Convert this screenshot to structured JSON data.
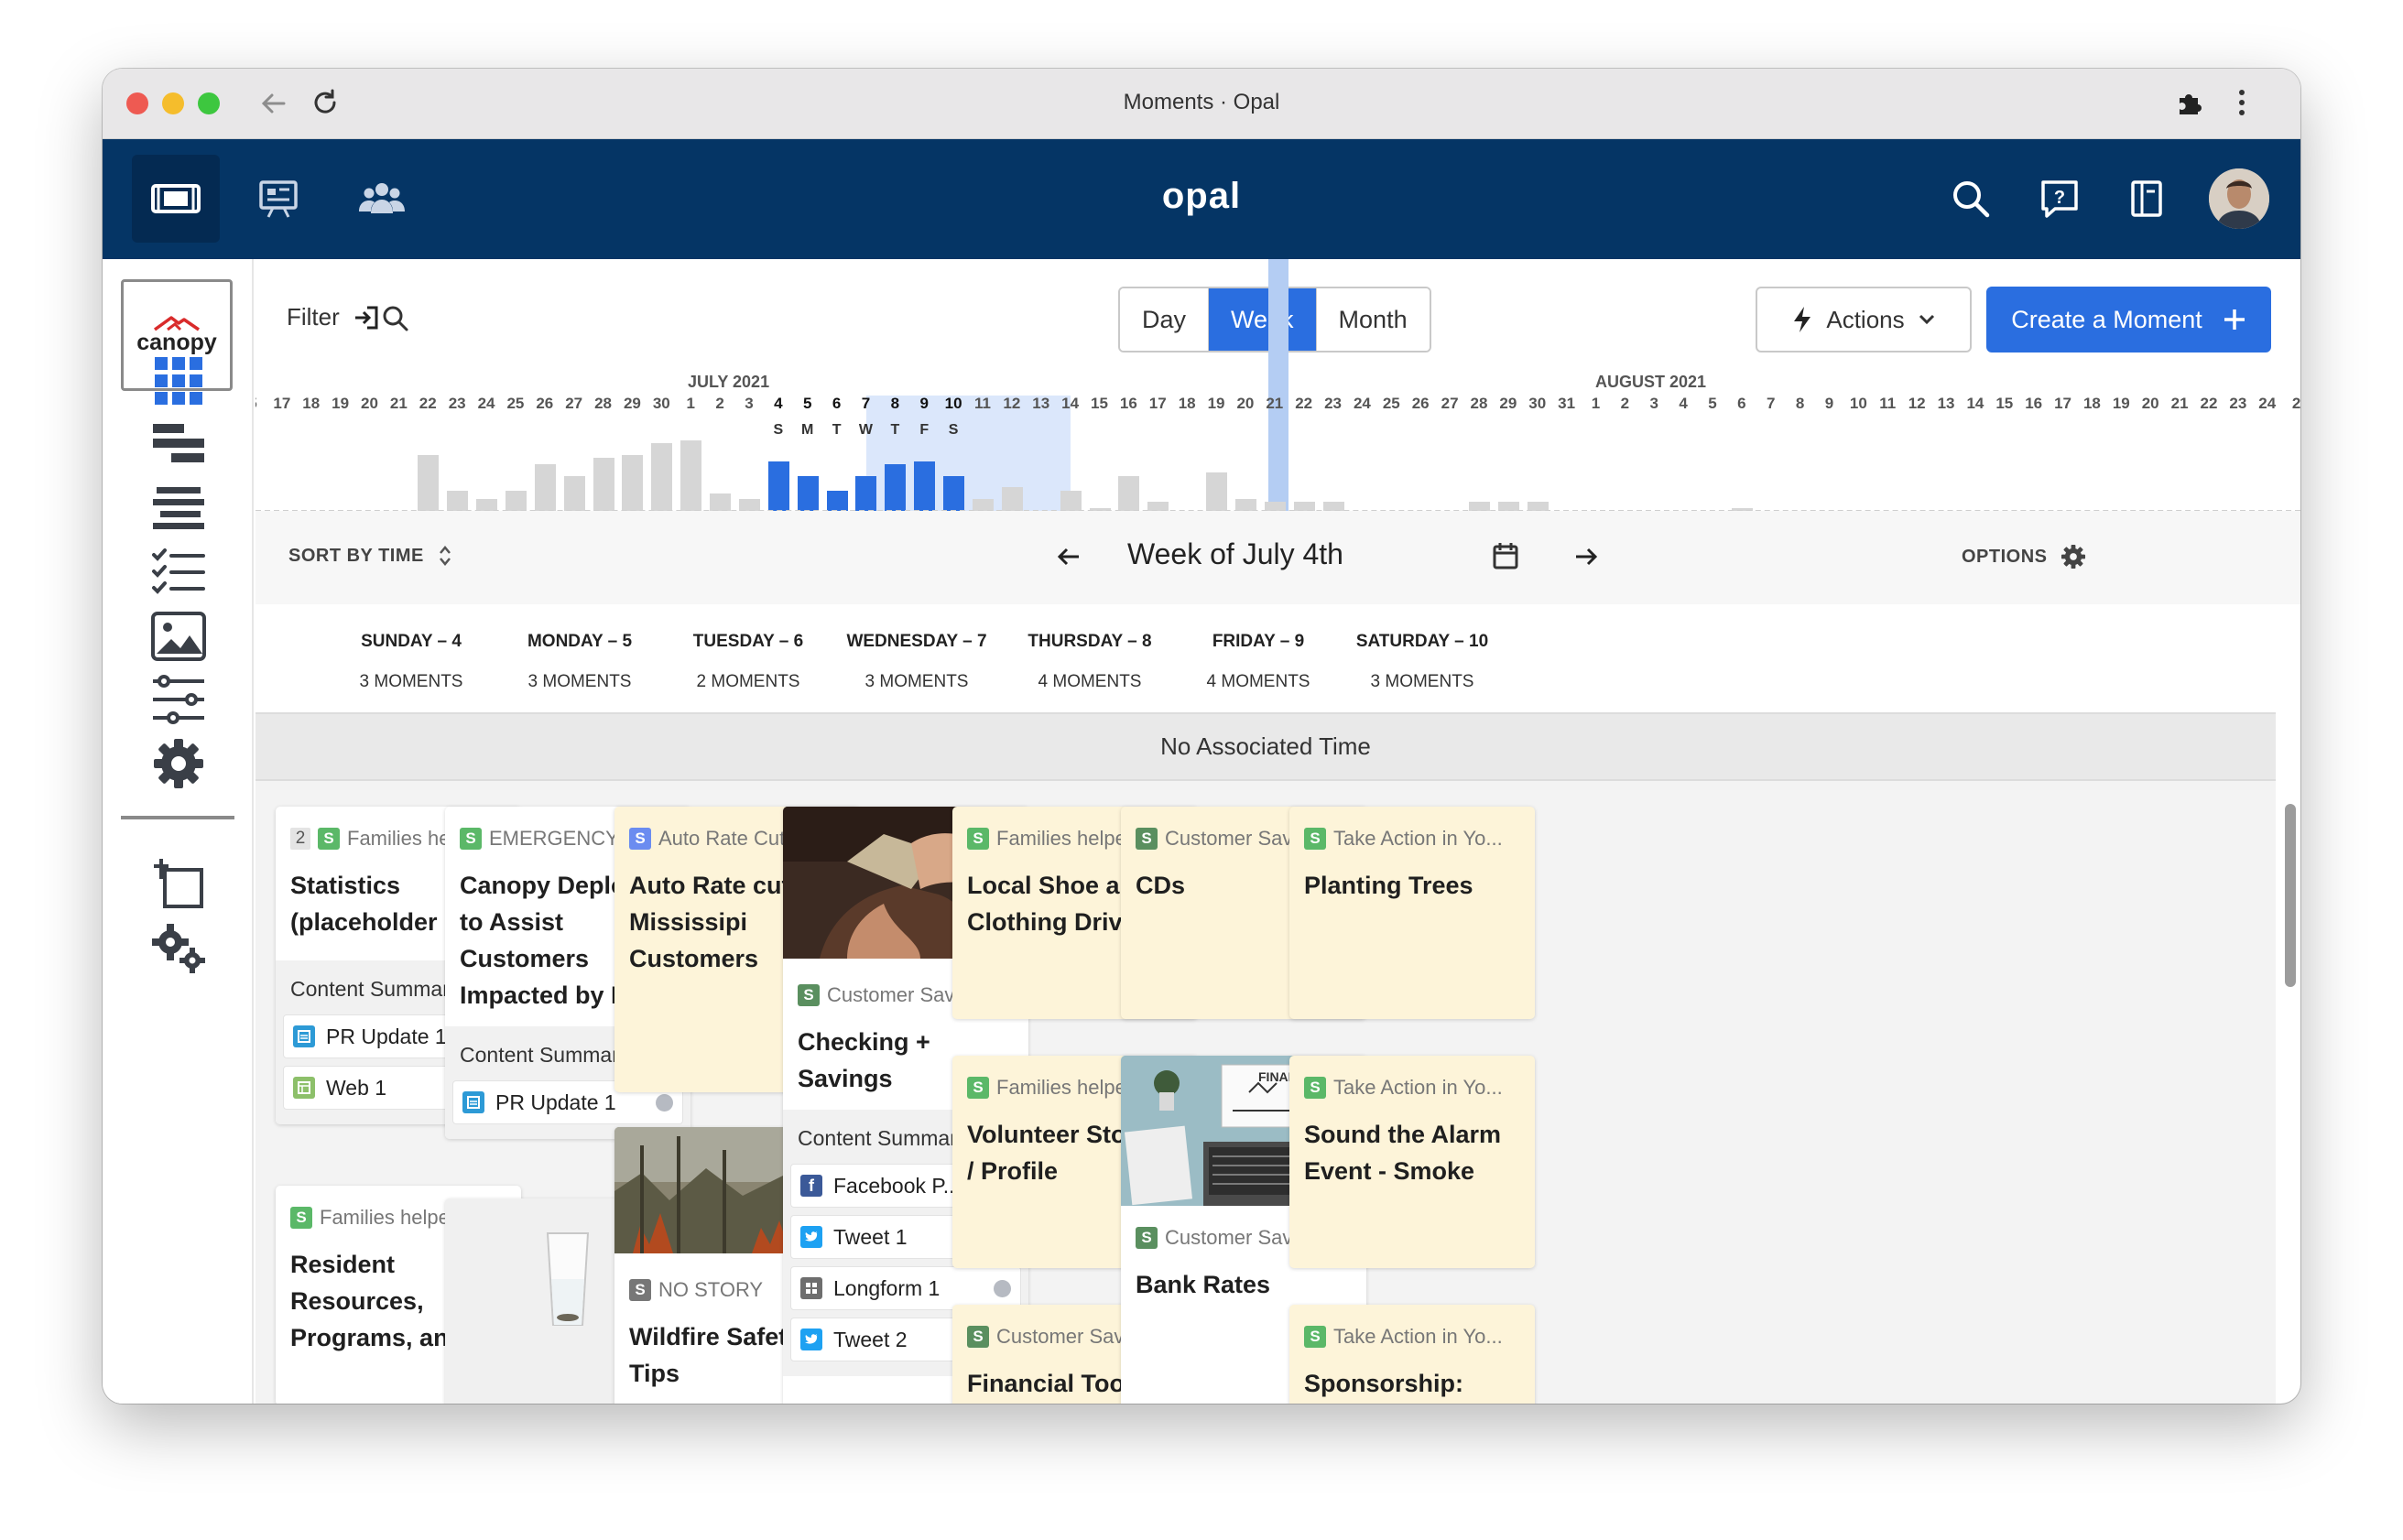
{
  "window": {
    "title": "Moments · Opal"
  },
  "topbar": {
    "logo": "opal"
  },
  "sidebar": {
    "brand": "canopy"
  },
  "toolbar": {
    "filter_label": "Filter",
    "views": [
      "Day",
      "Week",
      "Month"
    ],
    "active_view": "Week",
    "actions_label": "Actions",
    "create_label": "Create a Moment"
  },
  "timeline": {
    "months": [
      "JULY 2021",
      "AUGUST 2021"
    ],
    "days": [
      "5",
      "17",
      "18",
      "19",
      "20",
      "21",
      "22",
      "23",
      "24",
      "25",
      "26",
      "27",
      "28",
      "29",
      "30",
      "1",
      "2",
      "3",
      "4",
      "5",
      "6",
      "7",
      "8",
      "9",
      "10",
      "11",
      "12",
      "13",
      "14",
      "15",
      "16",
      "17",
      "18",
      "19",
      "20",
      "21",
      "22",
      "23",
      "24",
      "25",
      "26",
      "27",
      "28",
      "29",
      "30",
      "31",
      "1",
      "2",
      "3",
      "4",
      "5",
      "6",
      "7",
      "8",
      "9",
      "10",
      "11",
      "12",
      "13",
      "14",
      "15",
      "16",
      "17",
      "18",
      "19",
      "20",
      "21",
      "22",
      "23",
      "24",
      "2"
    ],
    "weekday_letters": [
      "S",
      "M",
      "T",
      "W",
      "T",
      "F",
      "S"
    ],
    "selected_range": [
      "4",
      "10"
    ],
    "bar_values": [
      0,
      0,
      0,
      0,
      0,
      0,
      19,
      7,
      4,
      7,
      16,
      12,
      18,
      19,
      23,
      24,
      6,
      4,
      17,
      12,
      7,
      12,
      16,
      17,
      12,
      4,
      8,
      0,
      7,
      1,
      12,
      3,
      0,
      13,
      4,
      3,
      3,
      3,
      0,
      0,
      0,
      0,
      3,
      3,
      3,
      0,
      0,
      0,
      0,
      0,
      0,
      1,
      0,
      0,
      0,
      0,
      0,
      0,
      0,
      0,
      0,
      0,
      0,
      0,
      0,
      0,
      0,
      0,
      0,
      0
    ]
  },
  "weekbar": {
    "sort_label": "SORT BY TIME",
    "title": "Week of July 4th",
    "options_label": "OPTIONS"
  },
  "days": [
    {
      "name": "SUNDAY – 4",
      "count": "3 MOMENTS"
    },
    {
      "name": "MONDAY – 5",
      "count": "3 MOMENTS"
    },
    {
      "name": "TUESDAY – 6",
      "count": "2 MOMENTS"
    },
    {
      "name": "WEDNESDAY – 7",
      "count": "3 MOMENTS"
    },
    {
      "name": "THURSDAY – 8",
      "count": "4 MOMENTS"
    },
    {
      "name": "FRIDAY – 9",
      "count": "4 MOMENTS"
    },
    {
      "name": "SATURDAY – 10",
      "count": "3 MOMENTS"
    }
  ],
  "no_associated_time": "No Associated Time",
  "cards": {
    "c1": {
      "num": "2",
      "story": "Families help...",
      "title": "Statistics (placeholder if",
      "summary": "Content Summary",
      "items": [
        "PR Update 1",
        "Web 1"
      ]
    },
    "c2": {
      "story": "Families helped i...",
      "title": "Resident Resources, Programs, and"
    },
    "c3": {
      "story": "EMERGENCY: Wi...",
      "title": "Canopy Deploys to Assist Customers Impacted by Fires",
      "summary": "Content Summary",
      "items": [
        "PR Update 1"
      ]
    },
    "c4": {
      "story": "Auto Rate Cut",
      "title": "Auto Rate cut for Mississipi Customers"
    },
    "c5": {
      "story": "NO STORY",
      "title": "Wildfire Safety Tips"
    },
    "c6": {
      "story": "Customer Savings",
      "title": "Checking + Savings",
      "summary": "Content Summary",
      "items": [
        "Facebook P...",
        "Tweet 1",
        "Longform 1",
        "Tweet 2"
      ]
    },
    "c7": {
      "story": "Families helped i...",
      "title": "Local Shoe and Clothing Drives"
    },
    "c8": {
      "story": "Families helped i...",
      "title": "Volunteer Stories / Profile"
    },
    "c9": {
      "story": "Customer Savings",
      "title": "Financial Tools +"
    },
    "c10": {
      "story": "Customer Savings",
      "title": "CDs"
    },
    "c11": {
      "story": "Customer Savings",
      "title": "Bank Rates",
      "image_caption": "FINANCE"
    },
    "c12": {
      "story": "Take Action in Yo...",
      "title": "Planting Trees"
    },
    "c13": {
      "story": "Take Action in Yo...",
      "title": "Sound the Alarm Event - Smoke"
    },
    "c14": {
      "story": "Take Action in Yo...",
      "title": "Sponsorship:"
    }
  },
  "colors": {
    "navy": "#053565",
    "accent": "#2a6ee0",
    "card_yellow": "#fdf4d9"
  }
}
